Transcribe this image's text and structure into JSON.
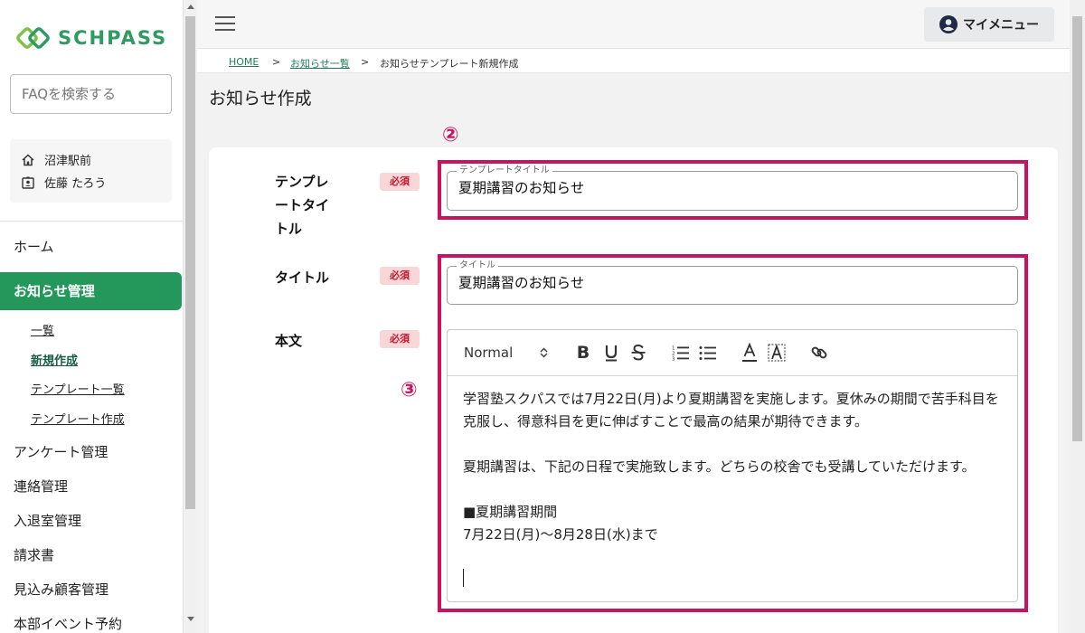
{
  "app": {
    "name": "SCHPASS",
    "brand_color": "#2e9b62",
    "accent_color": "#23985a",
    "highlight_color": "#c9135f"
  },
  "sidebar": {
    "search_placeholder": "FAQを検索する",
    "school": "沼津駅前",
    "user": "佐藤 たろう",
    "items": [
      {
        "label": "ホーム"
      },
      {
        "label": "お知らせ管理",
        "active": true
      },
      {
        "label": "アンケート管理"
      },
      {
        "label": "連絡管理"
      },
      {
        "label": "入退室管理"
      },
      {
        "label": "請求書"
      },
      {
        "label": "見込み顧客管理"
      },
      {
        "label": "本部イベント予約"
      }
    ],
    "sub_items": [
      {
        "label": "一覧"
      },
      {
        "label": "新規作成",
        "current": true
      },
      {
        "label": "テンプレート一覧"
      },
      {
        "label": "テンプレート作成"
      }
    ]
  },
  "header": {
    "menu_icon": "hamburger-icon",
    "mymenu_label": "マイメニュー"
  },
  "breadcrumb": {
    "home": "HOME",
    "list": "お知らせ一覧",
    "current": "お知らせテンプレート新規作成",
    "sep": ">"
  },
  "page": {
    "title": "お知らせ作成"
  },
  "form": {
    "required_badge": "必須",
    "markers": {
      "first": "②",
      "second": "③"
    },
    "template_title": {
      "label_lines": [
        "テンプレ",
        "ートタイ",
        "トル"
      ],
      "legend": "テンプレートタイトル",
      "value": "夏期講習のお知らせ"
    },
    "title": {
      "label": "タイトル",
      "legend": "タイトル",
      "value": "夏期講習のお知らせ"
    },
    "body": {
      "label": "本文",
      "toolbar": {
        "format": "Normal",
        "tools": [
          "bold-icon",
          "underline-icon",
          "strike-icon",
          "ordered-list-icon",
          "bullet-list-icon",
          "font-color-icon",
          "background-color-icon",
          "link-icon"
        ]
      },
      "paragraphs": [
        "学習塾スクパスでは7月22日(月)より夏期講習を実施します。夏休みの期間で苦手科目を克服し、得意科目を更に伸ばすことで最高の結果が期待できます。",
        "",
        "夏期講習は、下記の日程で実施致します。どちらの校舎でも受講していただけます。",
        "",
        "■夏期講習期間",
        "7月22日(月)〜8月28日(水)まで"
      ]
    }
  }
}
